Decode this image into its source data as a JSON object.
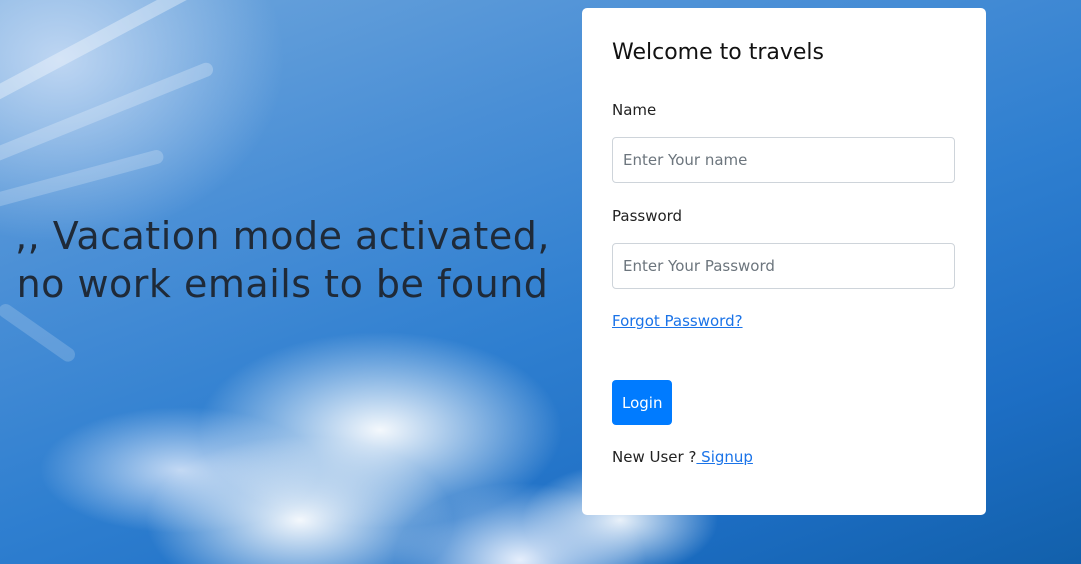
{
  "hero": {
    "quote_line1": ",, Vacation mode activated,",
    "quote_line2": "no work emails to be found"
  },
  "login_card": {
    "title": "Welcome to travels",
    "name_label": "Name",
    "name_placeholder": "Enter Your name",
    "name_value": "",
    "password_label": "Password",
    "password_placeholder": "Enter Your Password",
    "password_value": "",
    "forgot_link": "Forgot Password?",
    "login_button": "Login",
    "new_user_text": "New User ?",
    "signup_link": " Signup"
  },
  "colors": {
    "primary_button": "#007bff",
    "link": "#1a73e8",
    "card_background": "#ffffff"
  }
}
